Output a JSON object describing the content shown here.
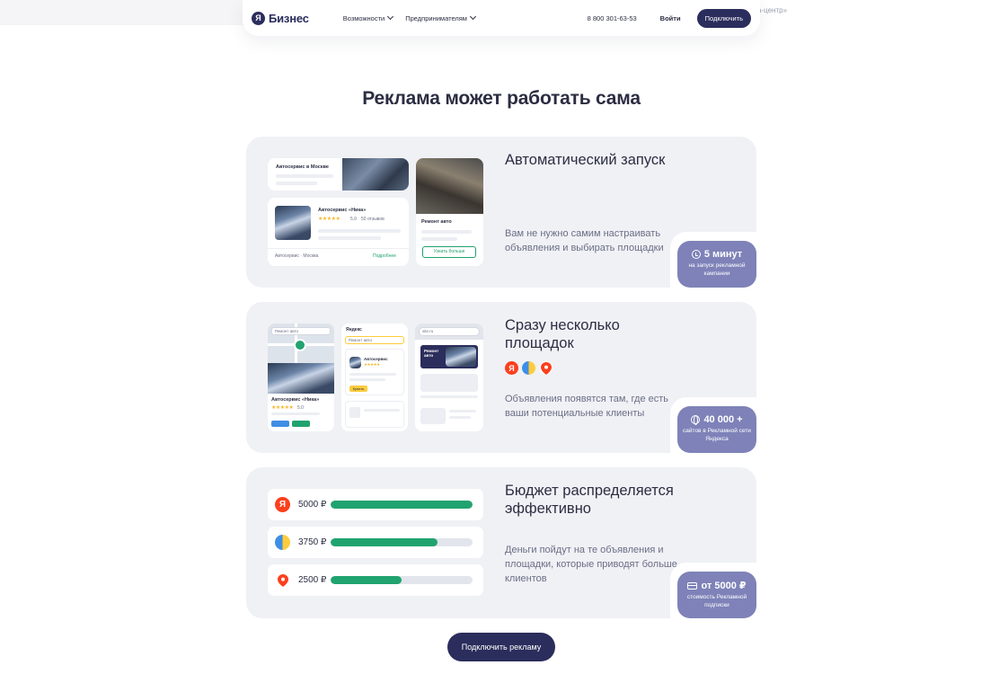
{
  "top": {
    "faded_text": "а-центр»"
  },
  "header": {
    "logo_mark": "Я",
    "logo_text": "Бизнес",
    "nav": [
      {
        "label": "Возможности"
      },
      {
        "label": "Предпринимателям"
      }
    ],
    "phone": "8 800 301-63-53",
    "login": "Войти",
    "connect": "Подключить"
  },
  "page_title": "Реклама может работать сама",
  "cards": [
    {
      "title": "Автоматический запуск",
      "description": "Вам не нужно самим настраивать объявления и выбирать площадки",
      "badge_value": "5 минут",
      "badge_caption": "на запуск рекламной кампании",
      "visual": {
        "search_query": "Автосервис в Москве",
        "shop_name": "Автосервис «Ника»",
        "rating": "5.0",
        "reviews": "50 отзывов",
        "stars": "★★★★★",
        "location": "Автосервис · Москва",
        "action_link": "Подробнее",
        "ad_title": "Ремонт авто",
        "ad_button": "Узнать больше"
      }
    },
    {
      "title": "Сразу несколько площадок",
      "description": "Объявления появятся там, где есть ваши потенциальные клиенты",
      "badge_value": "40 000 +",
      "badge_caption": "сайтов в Рекламной сети Яндекса",
      "visual": {
        "map_search": "Ремонт авто",
        "map_shop": "Автосервис «Ника»",
        "map_rating": "5.0",
        "stars": "★★★★★",
        "ya_logo": "Яндекс",
        "ya_search": "Ремонт авто",
        "ya_result": "Автосервис",
        "ya_button": "Купить",
        "banner_title": "Ремонт авто",
        "browser_url": "site.ru"
      },
      "platform_icons": [
        "yandex-icon",
        "network-icon",
        "maps-pin-icon"
      ]
    },
    {
      "title": "Бюджет распределяется эффективно",
      "description": "Деньги пойдут на те объявления и площадки, которые приводят больше клиентов",
      "badge_value": "от 5000 ₽",
      "badge_caption": "стоимость Рекламной подписки",
      "budget_rows": [
        {
          "icon": "yandex-icon",
          "amount": "5000 ₽",
          "share": 1.0
        },
        {
          "icon": "network-icon",
          "amount": "3750 ₽",
          "share": 0.75
        },
        {
          "icon": "maps-pin-icon",
          "amount": "2500 ₽",
          "share": 0.5
        }
      ]
    }
  ],
  "cta": "Подключить рекламу",
  "colors": {
    "brand_dark": "#2b2d5c",
    "badge": "#7e82b8",
    "card_bg": "#f0f1f5",
    "green": "#21a36f",
    "yandex_red": "#fc3f1d"
  }
}
